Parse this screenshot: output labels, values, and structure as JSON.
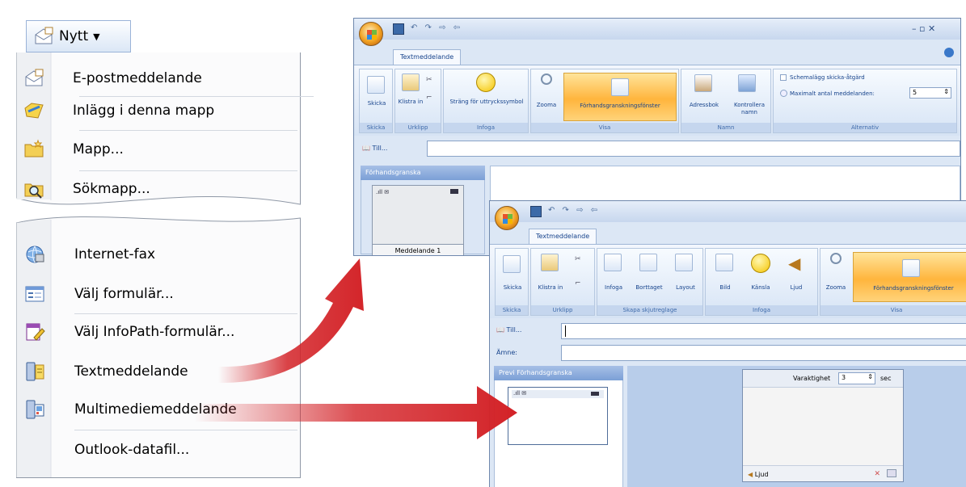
{
  "colors": {
    "arrow_red": "#d32227",
    "ribbon_blue": "#dce7f5",
    "highlight_orange": "#ffb53d",
    "pane_blue": "#b8cdea"
  },
  "menu": {
    "nytt_label": "Nytt",
    "nytt_icon": "new-mail-icon",
    "items_top": [
      {
        "label": "E-postmeddelande",
        "icon": "email-message-icon"
      },
      {
        "label": "Inlägg i denna mapp",
        "icon": "post-folder-icon"
      },
      {
        "label": "Mapp...",
        "icon": "folder-icon"
      },
      {
        "label": "Sökmapp...",
        "icon": "search-folder-icon"
      }
    ],
    "items_bottom": [
      {
        "label": "Internet-fax",
        "icon": "internet-fax-icon"
      },
      {
        "label": "Välj formulär...",
        "icon": "form-icon"
      },
      {
        "label": "Välj InfoPath-formulär...",
        "icon": "infopath-icon"
      },
      {
        "label": "Textmeddelande",
        "icon": "text-message-icon"
      },
      {
        "label": "Multimediemeddelande",
        "icon": "multimedia-message-icon"
      },
      {
        "label": "Outlook-datafil...",
        "icon": ""
      }
    ]
  },
  "window1": {
    "tab": "Textmeddelande",
    "qat": "↶ ↷ ⇨ ⇦",
    "title_buttons": "–  ▫  ✕",
    "buttons": {
      "skicka": "Skicka",
      "klistra": "Klistra in",
      "strang": "Sträng för uttryckssymbol",
      "zooma": "Zooma",
      "forhand": "Förhandsgranskningsfönster",
      "adressbok": "Adressbok",
      "kontrollera": "Kontrollera namn"
    },
    "groups": {
      "skicka": "Skicka",
      "urklipp": "Urklipp",
      "infoga": "Infoga",
      "visa": "Visa",
      "namn": "Namn",
      "alternativ": "Alternativ"
    },
    "options": {
      "schemalagg": "Schemalägg skicka-åtgärd",
      "max": "Maximalt antal meddelanden:",
      "max_value": "5"
    },
    "to_label": "Till...",
    "preview_header": "Förhandsgranska",
    "phone_caption": "Meddelande 1"
  },
  "window2": {
    "tab": "Textmeddelande",
    "qat": "↶ ↷ ⇨ ⇦",
    "buttons": {
      "skicka": "Skicka",
      "klistra": "Klistra in",
      "infoga": "Infoga",
      "borttaget": "Borttaget",
      "layout": "Layout",
      "bild": "Bild",
      "kansla": "Känsla",
      "ljud": "Ljud",
      "zooma": "Zooma",
      "forhand": "Förhandsgranskningsfönster"
    },
    "groups": {
      "skicka": "Skicka",
      "urklipp": "Urklipp",
      "skapa": "Skapa skjutreglage",
      "infoga": "Infoga",
      "visa": "Visa"
    },
    "to_label": "Till...",
    "subject_label": "Ämne:",
    "preview_header": "Previ Förhandsgranska",
    "slide": {
      "duration_label": "Varaktighet",
      "duration_value": "3",
      "unit": "sec",
      "sound_label": "Ljud"
    }
  }
}
